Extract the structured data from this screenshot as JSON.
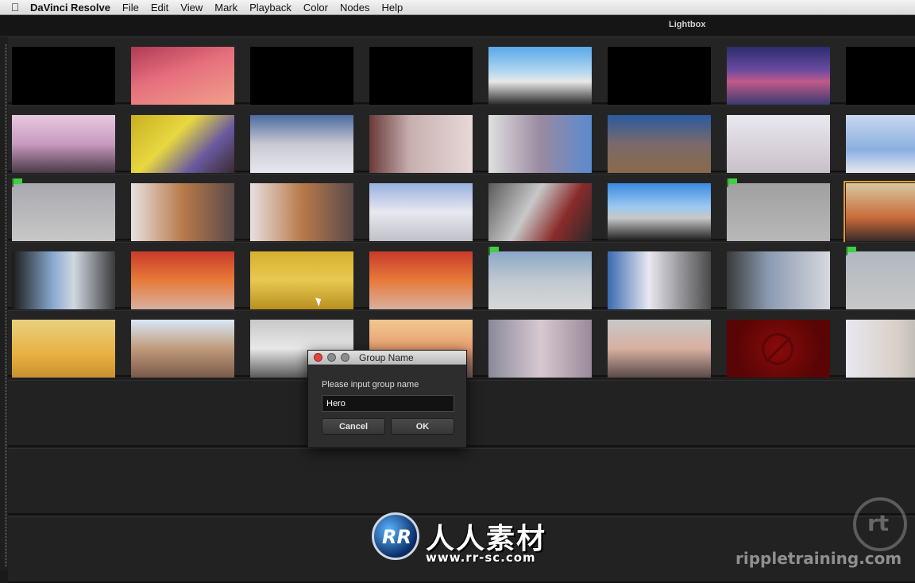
{
  "menubar": {
    "app_name": "DaVinci Resolve",
    "items": [
      "File",
      "Edit",
      "View",
      "Mark",
      "Playback",
      "Color",
      "Nodes",
      "Help"
    ]
  },
  "window": {
    "title": "Lightbox"
  },
  "lightbox": {
    "rows": [
      [
        {
          "bg": "#000000",
          "flag": false
        },
        {
          "bg": "linear-gradient(160deg,#b03a55,#e6707d 45%,#f0a08a)",
          "flag": false
        },
        {
          "bg": "#000000",
          "flag": false
        },
        {
          "bg": "#000000",
          "flag": false
        },
        {
          "bg": "linear-gradient(#5aa8e8 0%,#b7d9f0 45%,#e8e8e8 60%,#2a2a2a 100%)",
          "flag": false
        },
        {
          "bg": "#000000",
          "flag": false
        },
        {
          "bg": "linear-gradient(#2c2c6e,#6a4aa0 40%,#c05a8a 60%,#3a3a70)",
          "flag": false
        },
        {
          "bg": "#000000",
          "flag": false
        }
      ],
      [
        {
          "bg": "linear-gradient(#e8c8e0,#c89ac0 50%,#4a3a46)",
          "flag": false
        },
        {
          "bg": "linear-gradient(135deg,#c8b020,#e8d840 40%,#6a5aa0 70%,#3a2a30)",
          "flag": false
        },
        {
          "bg": "linear-gradient(#4a6aa0,#c8c8d0 50%,#e8e8f0)",
          "flag": false
        },
        {
          "bg": "linear-gradient(90deg,#6a3a3a,#c8b0b0 40%,#e8d8d8)",
          "flag": false
        },
        {
          "bg": "linear-gradient(90deg,#e0e0e0,#9a8aa0 50%,#5a8ad0)",
          "flag": false
        },
        {
          "bg": "linear-gradient(#2a5aa0,#7a6a6a 50%,#8a6a4a)",
          "flag": false
        },
        {
          "bg": "linear-gradient(#e8e8f0,#d8d0d8 60%,#c8c0c8)",
          "flag": false
        },
        {
          "bg": "linear-gradient(#c8d8f0,#8ab0e0 60%,#e8e8f0)",
          "flag": false
        }
      ],
      [
        {
          "bg": "linear-gradient(#a8a8b0,#c8c8c8)",
          "flag": true
        },
        {
          "bg": "linear-gradient(90deg,#e8e0e0,#b87a4a 50%,#5a4a4a)",
          "flag": false
        },
        {
          "bg": "linear-gradient(90deg,#e8e0e0,#b87a4a 50%,#5a4a4a)",
          "flag": false
        },
        {
          "bg": "linear-gradient(#9ab0e0,#e8e8f0 50%,#c0c0c8)",
          "flag": false
        },
        {
          "bg": "linear-gradient(120deg,#5a5a5a,#c8c8c8 40%,#8a2a2a 70%,#2a2a2a)",
          "flag": false
        },
        {
          "bg": "linear-gradient(#3a8ae0,#9ac8f0 40%,#c8c8c8 60%,#1a1a1a)",
          "flag": false
        },
        {
          "bg": "linear-gradient(#a0a0a0,#b8b8b8)",
          "flag": true
        },
        {
          "bg": "linear-gradient(#d8c8a0,#c86a3a 60%,#3a2a2a)",
          "flag": false,
          "selected": true
        }
      ],
      [
        {
          "bg": "linear-gradient(90deg,#1a1a1a,#8aaad0 40%,#d0d8e0 60%,#3a3a3a)",
          "flag": false
        },
        {
          "bg": "linear-gradient(#c83a2a,#e87a3a 50%,#d8b0a0)",
          "flag": false
        },
        {
          "bg": "linear-gradient(#d8b030,#e8c850 50%,#b89020)",
          "flag": false
        },
        {
          "bg": "linear-gradient(#c83a2a,#e87a3a 50%,#d8b0a0)",
          "flag": false
        },
        {
          "bg": "linear-gradient(#8aa8c8,#c0c8d0 50%,#d8d8d8)",
          "flag": true
        },
        {
          "bg": "linear-gradient(90deg,#3a6ab0,#e8e8f0 40%,#4a4a4a)",
          "flag": false
        },
        {
          "bg": "linear-gradient(90deg,#3a3a3a,#8a9ab0 40%,#d8d8e0)",
          "flag": false
        },
        {
          "bg": "linear-gradient(#b0b8c0,#c8c8c8)",
          "flag": true
        }
      ],
      [
        {
          "bg": "linear-gradient(#e8d080,#e8b040 60%,#c89030)",
          "flag": false
        },
        {
          "bg": "linear-gradient(#d8e8f8,#c09a7a 50%,#7a5a4a)",
          "flag": false
        },
        {
          "bg": "linear-gradient(#c8c8c8,#e8e8e8 50%,#5a5a5a)",
          "flag": false
        },
        {
          "bg": "linear-gradient(#f0c890,#e8a070 50%,#7a5a5a)",
          "flag": false
        },
        {
          "bg": "linear-gradient(90deg,#8a8a9a,#d8c8d0 50%,#9a8a9a)",
          "flag": false
        },
        {
          "bg": "linear-gradient(#c8c8c8,#d8b0a0 50%,#5a4a4a)",
          "flag": false
        },
        {
          "bg": "radial-gradient(circle,#8a0a0a,#5a0505 70%)",
          "flag": false,
          "no_entry": true
        },
        {
          "bg": "linear-gradient(90deg,#e8e8f0,#d8d0c8 50%,#9a9a9a)",
          "flag": false
        }
      ]
    ]
  },
  "dialog": {
    "title": "Group Name",
    "prompt": "Please input group name",
    "input_value": "Hero",
    "cancel_label": "Cancel",
    "ok_label": "OK",
    "traffic_colors": [
      "#e0443e",
      "#8c8c8c",
      "#8c8c8c"
    ]
  },
  "watermark": {
    "logo_text": "RR",
    "cn_text": "人人素材",
    "url": "www.rr-sc.com",
    "ripple_mark": "rt",
    "ripple_text": "rippletraining.com"
  }
}
